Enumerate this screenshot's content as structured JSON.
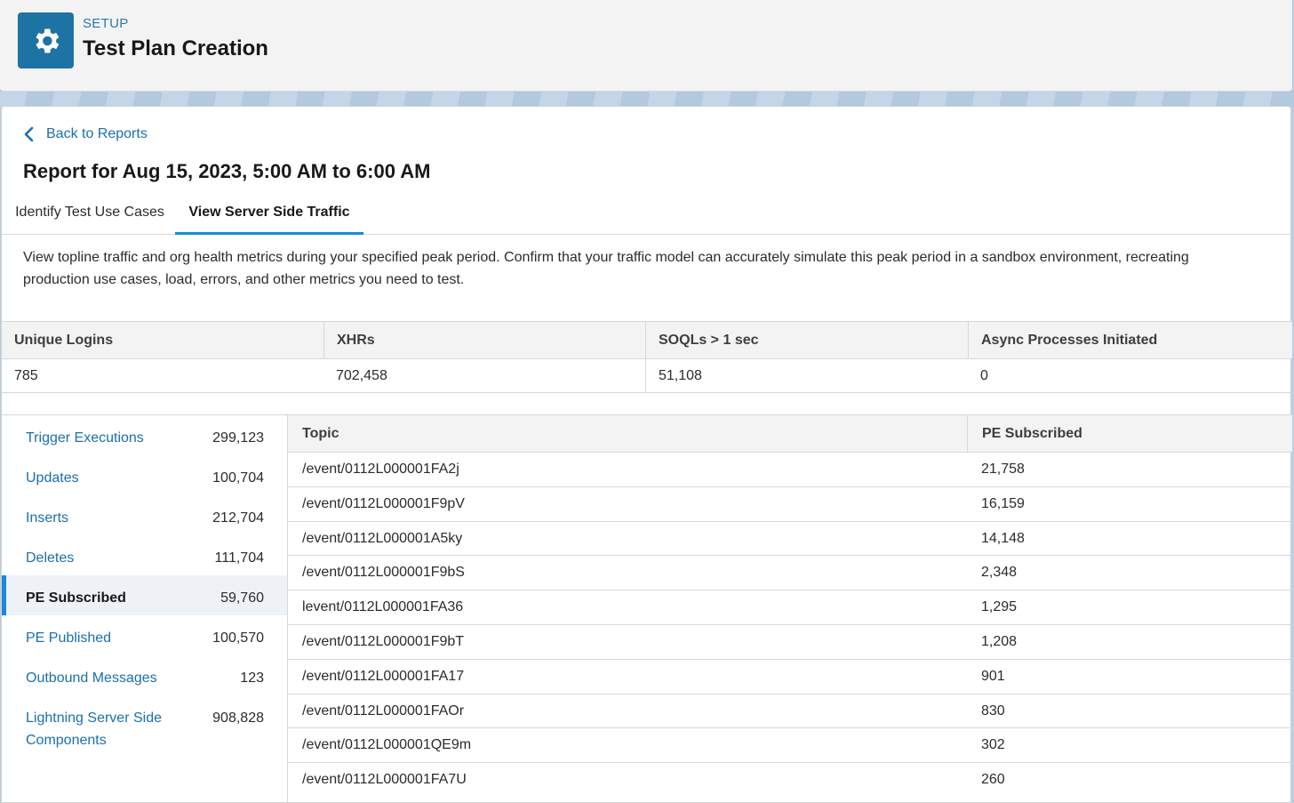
{
  "header": {
    "eyebrow": "SETUP",
    "title": "Test Plan Creation",
    "icon": "gear-icon"
  },
  "back_link": {
    "label": "Back to Reports",
    "icon": "chevron-left-icon"
  },
  "report_title": "Report for Aug 15, 2023, 5:00 AM to 6:00 AM",
  "tabs": [
    {
      "label": "Identify Test Use Cases",
      "active": false
    },
    {
      "label": "View Server Side Traffic",
      "active": true
    }
  ],
  "description": "View topline traffic and org health metrics during your specified peak period. Confirm that your traffic model can accurately simulate this peak period in a sandbox environment, recreating production use cases, load, errors, and other metrics you need to test.",
  "metrics": {
    "headers": [
      "Unique Logins",
      "XHRs",
      "SOQLs > 1 sec",
      "Async Processes Initiated"
    ],
    "values": [
      "785",
      "702,458",
      "51,108",
      "0"
    ]
  },
  "side_nav": [
    {
      "label": "Trigger Executions",
      "value": "299,123"
    },
    {
      "label": "Updates",
      "value": "100,704"
    },
    {
      "label": "Inserts",
      "value": "212,704"
    },
    {
      "label": "Deletes",
      "value": "111,704"
    },
    {
      "label": "PE Subscribed",
      "value": "59,760",
      "active": true
    },
    {
      "label": "PE Published",
      "value": "100,570"
    },
    {
      "label": "Outbound Messages",
      "value": "123"
    },
    {
      "label": "Lightning Server Side Components",
      "value": "908,828"
    }
  ],
  "topic_table": {
    "headers": [
      "Topic",
      "PE Subscribed"
    ],
    "rows": [
      [
        "/event/0112L000001FA2j",
        "21,758"
      ],
      [
        "/event/0112L000001F9pV",
        "16,159"
      ],
      [
        "/event/0112L000001A5ky",
        "14,148"
      ],
      [
        "/event/0112L000001F9bS",
        "2,348"
      ],
      [
        "levent/0112L000001FA36",
        "1,295"
      ],
      [
        "/event/0112L000001F9bT",
        "1,208"
      ],
      [
        "/event/0112L000001FA17",
        "901"
      ],
      [
        "/event/0112L000001FAOr",
        "830"
      ],
      [
        "/event/0112L000001QE9m",
        "302"
      ],
      [
        "/event/0112L000001FA7U",
        "260"
      ]
    ]
  },
  "colors": {
    "brand_icon_bg": "#1d73a3",
    "link": "#1a6fb0",
    "active_tab_underline": "#1b87d6"
  }
}
